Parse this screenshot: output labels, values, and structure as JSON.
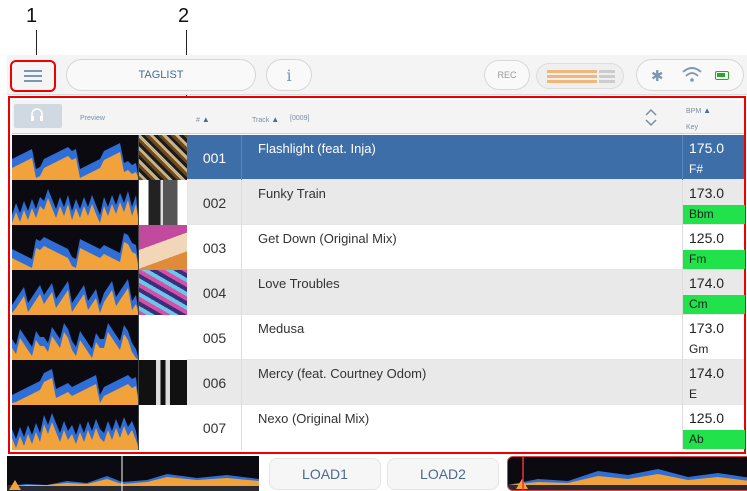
{
  "callouts": {
    "one": "1",
    "two": "2"
  },
  "header": {
    "taglist_label": "TAGLIST",
    "info_label": "i",
    "rec_label": "REC"
  },
  "columns": {
    "preview": "Preview",
    "number": "#",
    "track": "Track",
    "track_count": "[0009]",
    "bpm": "BPM",
    "key": "Key"
  },
  "tracks": [
    {
      "num": "001",
      "title": "Flashlight (feat. Inja)",
      "bpm": "175.0",
      "key": "F#",
      "key_highlight": false
    },
    {
      "num": "002",
      "title": "Funky Train",
      "bpm": "173.0",
      "key": "Bbm",
      "key_highlight": true
    },
    {
      "num": "003",
      "title": "Get Down (Original Mix)",
      "bpm": "125.0",
      "key": "Fm",
      "key_highlight": true
    },
    {
      "num": "004",
      "title": "Love Troubles",
      "bpm": "174.0",
      "key": "Cm",
      "key_highlight": true
    },
    {
      "num": "005",
      "title": "Medusa",
      "bpm": "173.0",
      "key": "Gm",
      "key_highlight": false
    },
    {
      "num": "006",
      "title": "Mercy (feat. Courtney Odom)",
      "bpm": "174.0",
      "key": "E",
      "key_highlight": false
    },
    {
      "num": "007",
      "title": "Nexo (Original Mix)",
      "bpm": "125.0",
      "key": "Ab",
      "key_highlight": true
    }
  ],
  "footer": {
    "load1_label": "LOAD1",
    "load2_label": "LOAD2"
  },
  "colors": {
    "selected_row": "#3d6ea7",
    "key_highlight": "#21e24a",
    "callout_box": "#e00000",
    "waveform_orange": "#f2a23a",
    "waveform_blue": "#2f6ed6"
  }
}
